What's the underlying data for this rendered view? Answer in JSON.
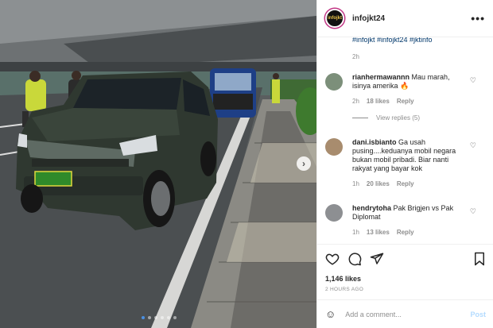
{
  "post": {
    "account": "infojkt24",
    "avatar_text": "infojkt",
    "caption_tail": "#infojkt #infojkt24 #jktinfo",
    "caption_time": "2h",
    "likes": "1,146 likes",
    "date": "2 HOURS AGO",
    "more_icon": "more-horizontal-icon",
    "colors": {
      "accent": "#0095f6",
      "ring": "#c13584",
      "muted": "#8e8e8e"
    }
  },
  "photo": {
    "plate_text": "",
    "next_icon": "chevron-right-icon",
    "slide_count": 6,
    "active_slide": 1
  },
  "comments": [
    {
      "user": "rianhermawannn",
      "text": "Mau marah, isinya amerika 🔥",
      "time": "2h",
      "likes": "18 likes",
      "reply": "Reply",
      "view_replies": "View replies (5)"
    },
    {
      "user": "dani.isbianto",
      "text": "Ga usah pusing....keduanya mobil negara bukan mobil pribadi. Biar nanti rakyat yang bayar kok",
      "time": "1h",
      "likes": "20 likes",
      "reply": "Reply"
    },
    {
      "user": "hendrytoha",
      "text": "Pak Brigjen vs Pak Diplomat",
      "time": "1h",
      "likes": "13 likes",
      "reply": "Reply"
    }
  ],
  "actions": {
    "like_icon": "heart-icon",
    "comment_icon": "comment-icon",
    "share_icon": "share-icon",
    "save_icon": "bookmark-icon"
  },
  "add_comment": {
    "placeholder": "Add a comment...",
    "post_label": "Post",
    "emoji_icon": "emoji-icon"
  }
}
